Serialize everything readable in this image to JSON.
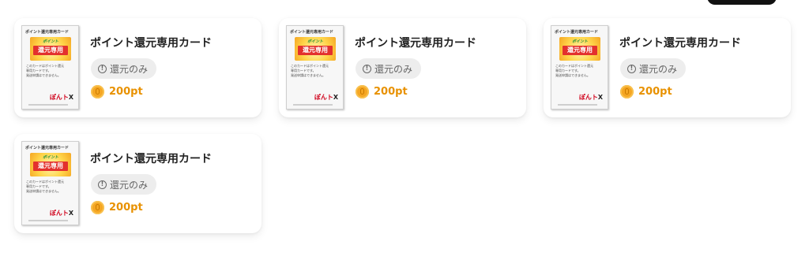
{
  "cards": [
    {
      "name": "ポイント還元専用カード",
      "badge": "還元のみ",
      "points": "200pt",
      "thumb": {
        "title": "ポイント還元専用カード",
        "art_sub": "ポイント",
        "art_main": "還元専用",
        "note1": "このカードはポイント還元",
        "note2": "専用カードです。",
        "note3": "発送申請はできません。",
        "logo": "ぽんト",
        "logo_x": "X"
      }
    },
    {
      "name": "ポイント還元専用カード",
      "badge": "還元のみ",
      "points": "200pt",
      "thumb": {
        "title": "ポイント還元専用カード",
        "art_sub": "ポイント",
        "art_main": "還元専用",
        "note1": "このカードはポイント還元",
        "note2": "専用カードです。",
        "note3": "発送申請はできません。",
        "logo": "ぽんト",
        "logo_x": "X"
      }
    },
    {
      "name": "ポイント還元専用カード",
      "badge": "還元のみ",
      "points": "200pt",
      "thumb": {
        "title": "ポイント還元専用カード",
        "art_sub": "ポイント",
        "art_main": "還元専用",
        "note1": "このカードはポイント還元",
        "note2": "専用カードです。",
        "note3": "発送申請はできません。",
        "logo": "ぽんト",
        "logo_x": "X"
      }
    },
    {
      "name": "ポイント還元専用カード",
      "badge": "還元のみ",
      "points": "200pt",
      "thumb": {
        "title": "ポイント還元専用カード",
        "art_sub": "ポイント",
        "art_main": "還元専用",
        "note1": "このカードはポイント還元",
        "note2": "専用カードです。",
        "note3": "発送申請はできません。",
        "logo": "ぽんト",
        "logo_x": "X"
      }
    }
  ],
  "icons": {
    "badge": "info-circle-icon",
    "points": "coin-icon"
  },
  "colors": {
    "points": "#e89100",
    "coin": "#f5a623",
    "badge_bg": "#ededed"
  }
}
